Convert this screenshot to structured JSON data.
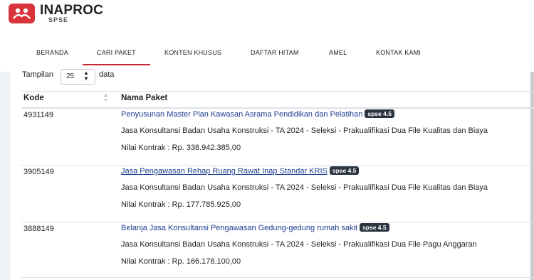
{
  "brand": {
    "title": "INAPROC",
    "subtitle": "SPSE"
  },
  "nav": [
    {
      "label": "BERANDA"
    },
    {
      "label": "CARI PAKET",
      "active": true
    },
    {
      "label": "KONTEN KHUSUS"
    },
    {
      "label": "DAFTAR HITAM"
    },
    {
      "label": "AMEL"
    },
    {
      "label": "KONTAK KAMI"
    }
  ],
  "length_control": {
    "prefix": "Tampilan",
    "value": "25",
    "suffix": "data"
  },
  "table": {
    "columns": [
      "Kode",
      "Nama Paket"
    ],
    "rows": [
      {
        "kode": "4931149",
        "title": "Penyusunan Master Plan Kawasan Asrama Pendidikan dan Pelatihan",
        "badge": "spse 4.5",
        "description": "Jasa Konsultansi Badan Usaha Konstruksi - TA 2024 - Seleksi - Prakualifikasi Dua File Kualitas dan Biaya",
        "nilai": "Nilai Kontrak : Rp. 338.942.385,00"
      },
      {
        "kode": "3905149",
        "title": "Jasa Pengawasan Rehap Ruang Rawat Inap Standar KRIS",
        "badge": "spse 4.5",
        "description": "Jasa Konsultansi Badan Usaha Konstruksi - TA 2024 - Seleksi - Prakualifikasi Dua File Kualitas dan Biaya",
        "nilai": "Nilai Kontrak : Rp. 177.785.925,00"
      },
      {
        "kode": "3888149",
        "title": "Belanja Jasa Konsultansi Pengawasan Gedung-gedung rumah sakit",
        "badge": "spse 4.5",
        "description": "Jasa Konsultansi Badan Usaha Konstruksi - TA 2024 - Seleksi - Prakualifikasi Dua File Pagu Anggaran",
        "nilai": "Nilai Kontrak : Rp. 166.178.100,00"
      }
    ]
  },
  "colors": {
    "brand_red": "#d9343c",
    "link_blue": "#1a3d8f",
    "badge_bg": "#2b3542"
  }
}
